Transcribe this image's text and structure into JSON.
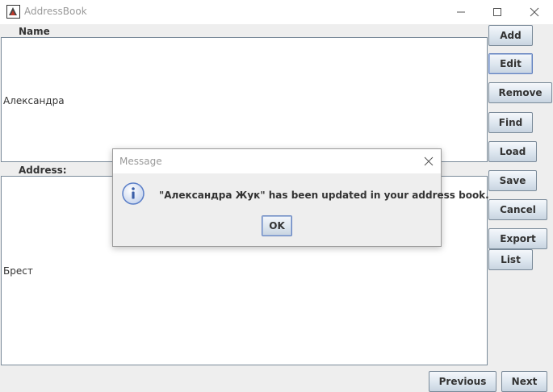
{
  "window": {
    "title": "AddressBook",
    "icons": {
      "app": "java-app-icon",
      "minimize": "minimize-icon",
      "maximize": "maximize-icon",
      "close": "close-icon"
    }
  },
  "form": {
    "name_label": "Name",
    "name_value": "Александра",
    "address_label": "Address:",
    "address_value": "Брест"
  },
  "buttons": {
    "add": "Add",
    "edit": "Edit",
    "remove": "Remove",
    "find": "Find",
    "load": "Load",
    "save": "Save",
    "cancel": "Cancel",
    "export": "Export",
    "list": "List",
    "previous": "Previous",
    "next": "Next"
  },
  "dialog": {
    "title": "Message",
    "message": "\"Александра Жук\" has been updated in your address book.",
    "ok_label": "OK",
    "icon": "info-icon"
  },
  "colors": {
    "button_border": "#7a8a99",
    "focus_border": "#6382bf",
    "info_icon": "#5b7fc8"
  }
}
